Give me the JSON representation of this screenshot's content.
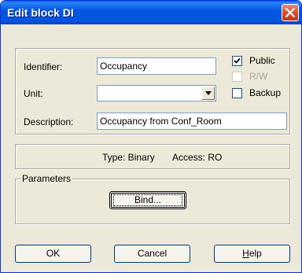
{
  "window": {
    "title": "Edit block DI"
  },
  "form": {
    "identifier_label": "Identifier:",
    "identifier_value": "Occupancy",
    "unit_label": "Unit:",
    "unit_value": "",
    "description_label": "Description:",
    "description_value": "Occupancy from Conf_Room",
    "public_label": "Public",
    "public_checked": true,
    "rw_label": "R/W",
    "rw_checked": false,
    "rw_enabled": false,
    "backup_label": "Backup",
    "backup_checked": false
  },
  "info": {
    "type_text": "Type: Binary",
    "access_text": "Access: RO"
  },
  "parameters": {
    "group_label": "Parameters",
    "bind_label": "Bind..."
  },
  "buttons": {
    "ok_label": "OK",
    "cancel_label": "Cancel",
    "help_label": "Help"
  },
  "icons": [
    "close-icon",
    "chevron-down-icon",
    "checkmark-icon"
  ]
}
